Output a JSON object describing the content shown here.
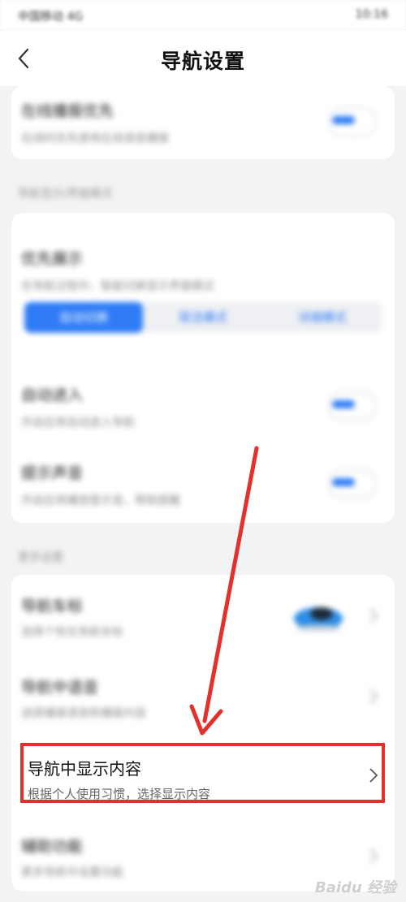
{
  "status_bar": {
    "left": "中国移动 4G",
    "right": "10:16"
  },
  "header": {
    "title": "导航设置"
  },
  "rows": {
    "online_weather": {
      "title": "在线播报优先",
      "sub": "在线时优先使用在线语音播报"
    },
    "section_display": "导航显示/界面模式",
    "priority_display": {
      "title": "优先展示",
      "sub": "在导航过程中，智能切换显示界面模式"
    },
    "segments": [
      "自动切换",
      "简洁模式",
      "详细模式"
    ],
    "auto_enter": {
      "title": "自动进入",
      "sub": "开启后将自动进入导航"
    },
    "prompt_sound": {
      "title": "提示声音",
      "sub": "开启后将播放提示音，帮助提醒"
    },
    "section_more": "更多设置",
    "nav_car": {
      "title": "导航车标",
      "sub": "选择个性化导航车标"
    },
    "nav_voice": {
      "title": "导航中语音",
      "sub": "选择播报语音和播报内容"
    },
    "nav_content": {
      "title": "导航中显示内容",
      "sub": "根据个人使用习惯，选择显示内容"
    },
    "assist": {
      "title": "辅助功能",
      "sub": "更多导航中设置功能"
    }
  },
  "watermark": "Baidu 经验"
}
